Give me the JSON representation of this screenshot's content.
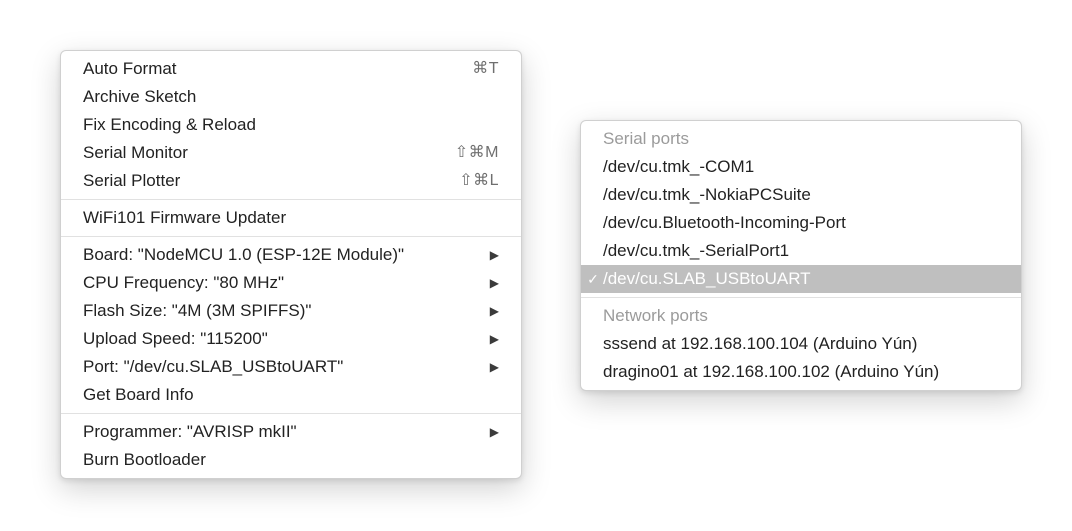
{
  "left_menu": {
    "groups": [
      [
        {
          "label": "Auto Format",
          "shortcut": "⌘T",
          "submenu": false
        },
        {
          "label": "Archive Sketch",
          "shortcut": "",
          "submenu": false
        },
        {
          "label": "Fix Encoding & Reload",
          "shortcut": "",
          "submenu": false
        },
        {
          "label": "Serial Monitor",
          "shortcut": "⇧⌘M",
          "submenu": false
        },
        {
          "label": "Serial Plotter",
          "shortcut": "⇧⌘L",
          "submenu": false
        }
      ],
      [
        {
          "label": "WiFi101 Firmware Updater",
          "shortcut": "",
          "submenu": false
        }
      ],
      [
        {
          "label": "Board: \"NodeMCU 1.0 (ESP-12E Module)\"",
          "shortcut": "",
          "submenu": true
        },
        {
          "label": "CPU Frequency: \"80 MHz\"",
          "shortcut": "",
          "submenu": true
        },
        {
          "label": "Flash Size: \"4M (3M SPIFFS)\"",
          "shortcut": "",
          "submenu": true
        },
        {
          "label": "Upload Speed: \"115200\"",
          "shortcut": "",
          "submenu": true
        },
        {
          "label": "Port: \"/dev/cu.SLAB_USBtoUART\"",
          "shortcut": "",
          "submenu": true
        },
        {
          "label": "Get Board Info",
          "shortcut": "",
          "submenu": false
        }
      ],
      [
        {
          "label": "Programmer: \"AVRISP mkII\"",
          "shortcut": "",
          "submenu": true
        },
        {
          "label": "Burn Bootloader",
          "shortcut": "",
          "submenu": false
        }
      ]
    ]
  },
  "right_menu": {
    "groups": [
      {
        "header": "Serial ports",
        "items": [
          {
            "label": "/dev/cu.tmk_-COM1",
            "checked": false,
            "selected": false
          },
          {
            "label": "/dev/cu.tmk_-NokiaPCSuite",
            "checked": false,
            "selected": false
          },
          {
            "label": "/dev/cu.Bluetooth-Incoming-Port",
            "checked": false,
            "selected": false
          },
          {
            "label": "/dev/cu.tmk_-SerialPort1",
            "checked": false,
            "selected": false
          },
          {
            "label": "/dev/cu.SLAB_USBtoUART",
            "checked": true,
            "selected": true
          }
        ]
      },
      {
        "header": "Network ports",
        "items": [
          {
            "label": "sssend at 192.168.100.104 (Arduino Yún)",
            "checked": false,
            "selected": false
          },
          {
            "label": "dragino01 at 192.168.100.102 (Arduino Yún)",
            "checked": false,
            "selected": false
          }
        ]
      }
    ]
  },
  "glyphs": {
    "arrow": "▶",
    "check": "✓"
  }
}
